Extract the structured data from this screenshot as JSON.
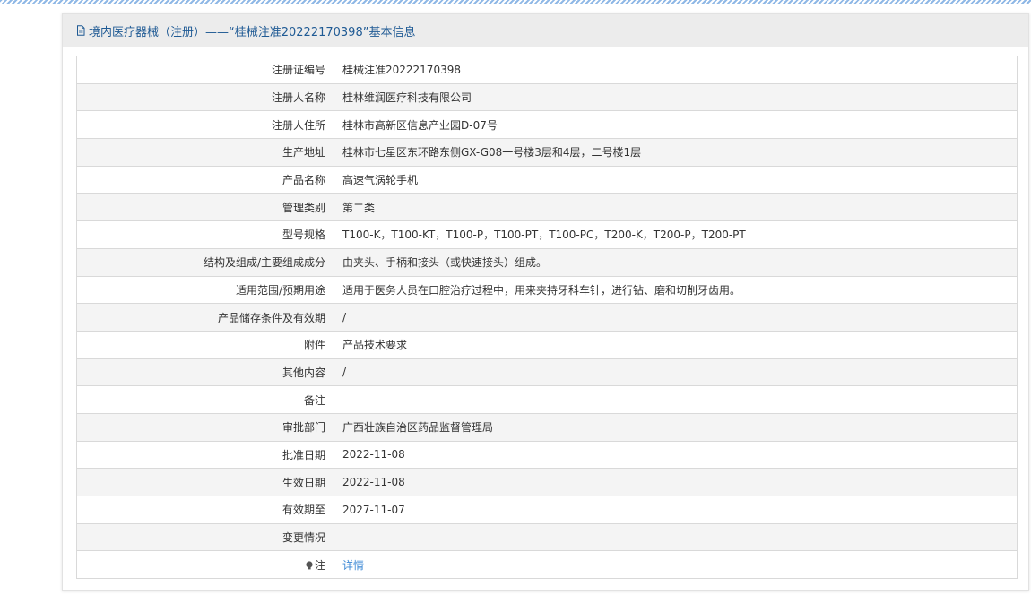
{
  "header": {
    "title": "境内医疗器械（注册）——“桂械注准20222170398”基本信息",
    "icon": "document-icon"
  },
  "rows": [
    {
      "label": "注册证编号",
      "value": "桂械注准20222170398"
    },
    {
      "label": "注册人名称",
      "value": "桂林维润医疗科技有限公司"
    },
    {
      "label": "注册人住所",
      "value": "桂林市高新区信息产业园D-07号"
    },
    {
      "label": "生产地址",
      "value": "桂林市七星区东环路东侧GX-G08一号楼3层和4层，二号楼1层"
    },
    {
      "label": "产品名称",
      "value": "高速气涡轮手机"
    },
    {
      "label": "管理类别",
      "value": "第二类"
    },
    {
      "label": "型号规格",
      "value": "T100-K，T100-KT，T100-P，T100-PT，T100-PC，T200-K，T200-P，T200-PT"
    },
    {
      "label": "结构及组成/主要组成成分",
      "value": "由夹头、手柄和接头（或快速接头）组成。"
    },
    {
      "label": "适用范围/预期用途",
      "value": "适用于医务人员在口腔治疗过程中，用来夹持牙科车针，进行钻、磨和切削牙齿用。"
    },
    {
      "label": "产品储存条件及有效期",
      "value": "/"
    },
    {
      "label": "附件",
      "value": "产品技术要求"
    },
    {
      "label": "其他内容",
      "value": "/"
    },
    {
      "label": "备注",
      "value": ""
    },
    {
      "label": "审批部门",
      "value": "广西壮族自治区药品监督管理局"
    },
    {
      "label": "批准日期",
      "value": "2022-11-08"
    },
    {
      "label": "生效日期",
      "value": "2022-11-08"
    },
    {
      "label": "有效期至",
      "value": "2027-11-07"
    },
    {
      "label": "变更情况",
      "value": ""
    }
  ],
  "note_row": {
    "label": "注",
    "icon": "lightbulb-icon",
    "link_text": "详情"
  },
  "colors": {
    "header_text": "#1f5a94",
    "link": "#3a87d4",
    "header_bg": "#ececec",
    "stripe_row": "#f4f4f4"
  }
}
